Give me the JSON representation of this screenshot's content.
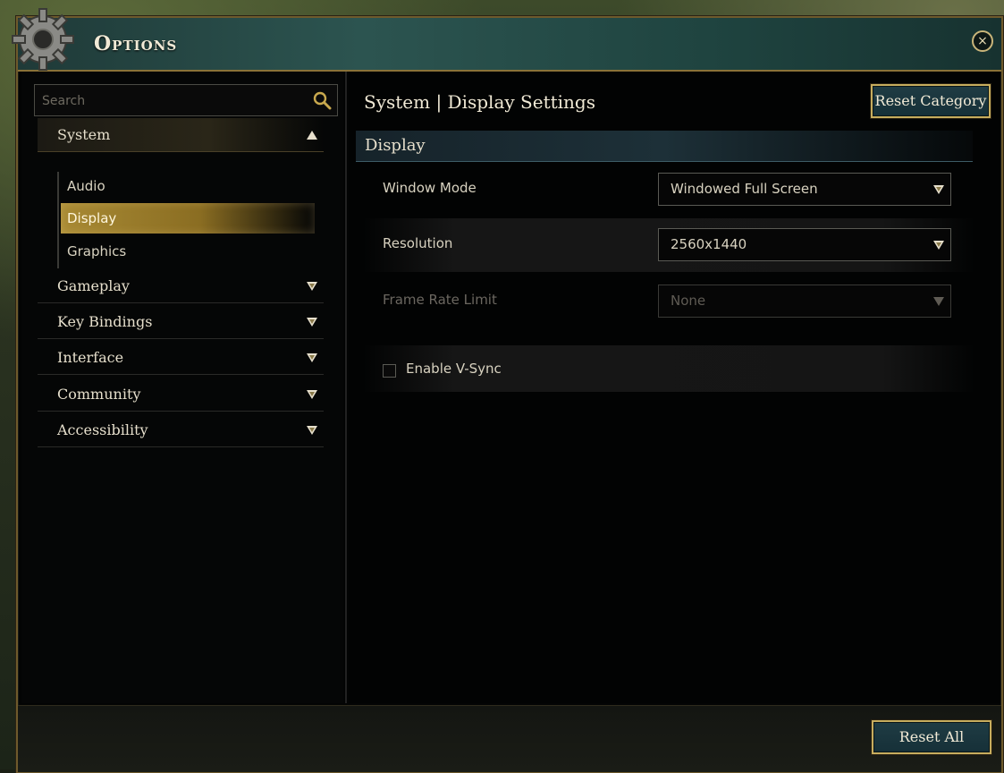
{
  "window": {
    "title": "Options"
  },
  "search": {
    "placeholder": "Search"
  },
  "sidebar": {
    "system": {
      "label": "System",
      "subitems": [
        {
          "label": "Audio"
        },
        {
          "label": "Display"
        },
        {
          "label": "Graphics"
        }
      ]
    },
    "categories": [
      {
        "label": "Gameplay"
      },
      {
        "label": "Key Bindings"
      },
      {
        "label": "Interface"
      },
      {
        "label": "Community"
      },
      {
        "label": "Accessibility"
      }
    ]
  },
  "main": {
    "title": "System | Display Settings",
    "reset_category": "Reset Category",
    "section": "Display",
    "settings": {
      "window_mode": {
        "label": "Window Mode",
        "value": "Windowed Full Screen"
      },
      "resolution": {
        "label": "Resolution",
        "value": "2560x1440"
      },
      "frame_rate_limit": {
        "label": "Frame Rate Limit",
        "value": "None"
      },
      "vsync": {
        "label": "Enable V-Sync",
        "checked": false
      }
    }
  },
  "footer": {
    "reset_all": "Reset All"
  },
  "colors": {
    "accent_gold": "#c7ad5e",
    "title_teal": "#2c5450",
    "active_item": "#a88a34"
  }
}
